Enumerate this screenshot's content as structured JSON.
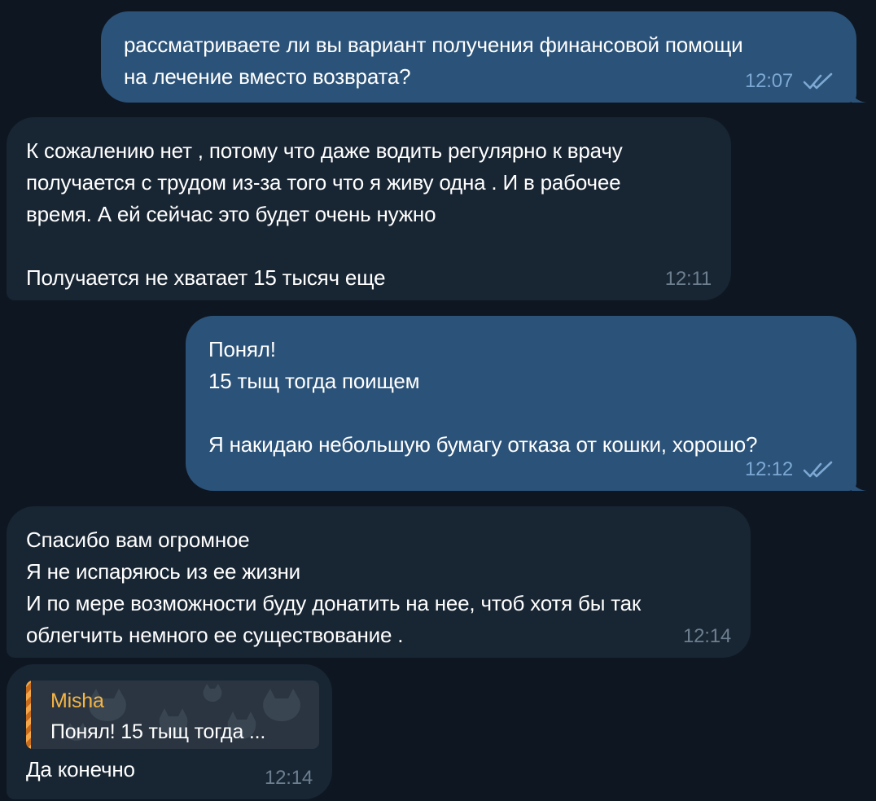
{
  "messages": [
    {
      "direction": "out",
      "text": "рассматриваете ли вы вариант получения финансовой помощи\nна лечение вместо возврата?",
      "time": "12:07",
      "read": true
    },
    {
      "direction": "in",
      "text": "К сожалению нет , потому что даже водить регулярно к врачу\nполучается с трудом из-за того что я живу одна . И в рабочее\nвремя. А ей сейчас это будет очень нужно\n\nПолучается не хватает 15 тысяч еще",
      "time": "12:11"
    },
    {
      "direction": "out",
      "text": "Понял!\n15 тыщ тогда поищем\n\nЯ накидаю небольшую бумагу отказа от кошки, хорошо?",
      "time": "12:12",
      "read": true
    },
    {
      "direction": "in",
      "text": "Спасибо вам огромное\nЯ не испаряюсь из ее жизни\nИ по мере возможности буду донатить на нее, чтоб хотя бы так\nоблегчить немного ее существование .",
      "time": "12:14"
    },
    {
      "direction": "in",
      "reply": {
        "name": "Misha",
        "snippet": "Понял! 15 тыщ тогда ..."
      },
      "text": "Да конечно",
      "time": "12:14"
    }
  ],
  "colors": {
    "background": "#0e1621",
    "outgoing_bubble": "#2b5278",
    "incoming_bubble": "#182533",
    "reply_name": "#f5b544"
  },
  "icons": {
    "read_status": "double-check-icon",
    "reply_background": "cat-pattern"
  }
}
